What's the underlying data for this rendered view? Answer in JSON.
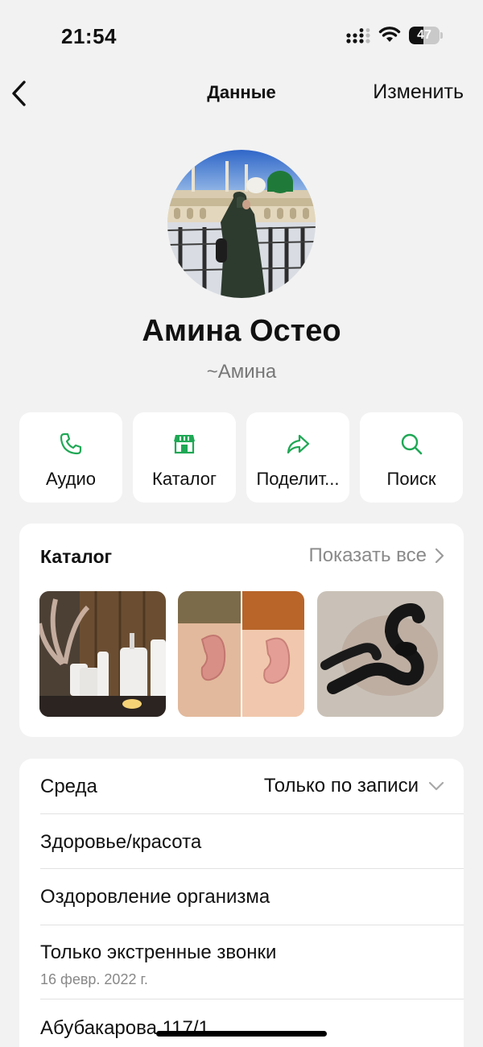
{
  "status_bar": {
    "time": "21:54",
    "battery": "47"
  },
  "nav": {
    "title": "Данные",
    "edit_label": "Изменить"
  },
  "profile": {
    "name": "Амина Остео",
    "subtitle": "~Амина"
  },
  "actions": [
    {
      "label": "Аудио",
      "icon": "phone-icon"
    },
    {
      "label": "Каталог",
      "icon": "store-icon"
    },
    {
      "label": "Поделит...",
      "icon": "share-icon"
    },
    {
      "label": "Поиск",
      "icon": "search-icon"
    }
  ],
  "catalog": {
    "title": "Каталог",
    "show_all_label": "Показать все"
  },
  "info": {
    "rows": [
      {
        "label": "Среда",
        "value": "Только по записи"
      },
      {
        "label": "Здоровье/красота"
      },
      {
        "label": "Оздоровление организма"
      },
      {
        "label": "Только экстренные звонки",
        "sub": "16 февр. 2022 г."
      },
      {
        "label": "Абубакарова 117/1"
      }
    ]
  },
  "colors": {
    "accent": "#1fa855",
    "background": "#f2f2f2",
    "card": "#ffffff",
    "secondary_text": "#8a8a8a"
  }
}
